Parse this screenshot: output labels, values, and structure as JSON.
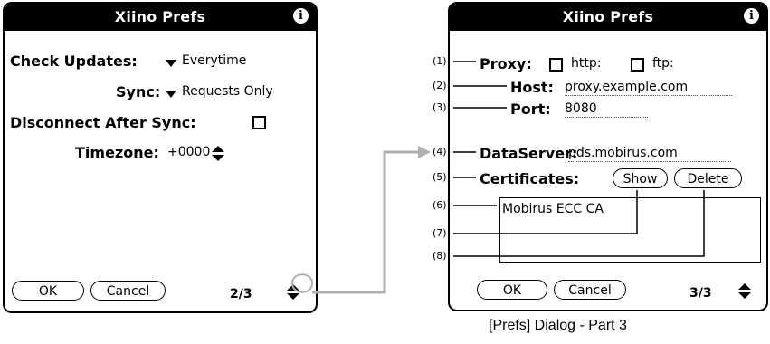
{
  "left_dialog": {
    "title": "Xiino Prefs",
    "info_icon": "info-icon",
    "check_updates": {
      "label": "Check Updates:",
      "value": "Everytime"
    },
    "sync": {
      "label": "Sync:",
      "value": "Requests Only"
    },
    "disconnect_after_sync": {
      "label": "Disconnect After Sync:",
      "checked": false
    },
    "timezone": {
      "label": "Timezone:",
      "value": "+0000"
    },
    "ok_label": "OK",
    "cancel_label": "Cancel",
    "page_indicator": "2/3"
  },
  "right_dialog": {
    "title": "Xiino Prefs",
    "info_icon": "info-icon",
    "proxy": {
      "label": "Proxy:",
      "http_label": "http:",
      "ftp_label": "ftp:",
      "http_checked": false,
      "ftp_checked": false
    },
    "host": {
      "label": "Host:",
      "value": "proxy.example.com"
    },
    "port": {
      "label": "Port:",
      "value": "8080"
    },
    "dataserver": {
      "label": "DataServer:",
      "value": "pds.mobirus.com"
    },
    "certificates": {
      "label": "Certificates:",
      "show_label": "Show",
      "delete_label": "Delete"
    },
    "certificate_list": [
      "Mobirus ECC CA"
    ],
    "ok_label": "OK",
    "cancel_label": "Cancel",
    "page_indicator": "3/3"
  },
  "markers": [
    "(1)",
    "(2)",
    "(3)",
    "(4)",
    "(5)",
    "(6)",
    "(7)",
    "(8)"
  ],
  "caption": "[Prefs] Dialog - Part 3",
  "colors": {
    "connector": "#b0b0b0",
    "titlebar": "#000000"
  }
}
